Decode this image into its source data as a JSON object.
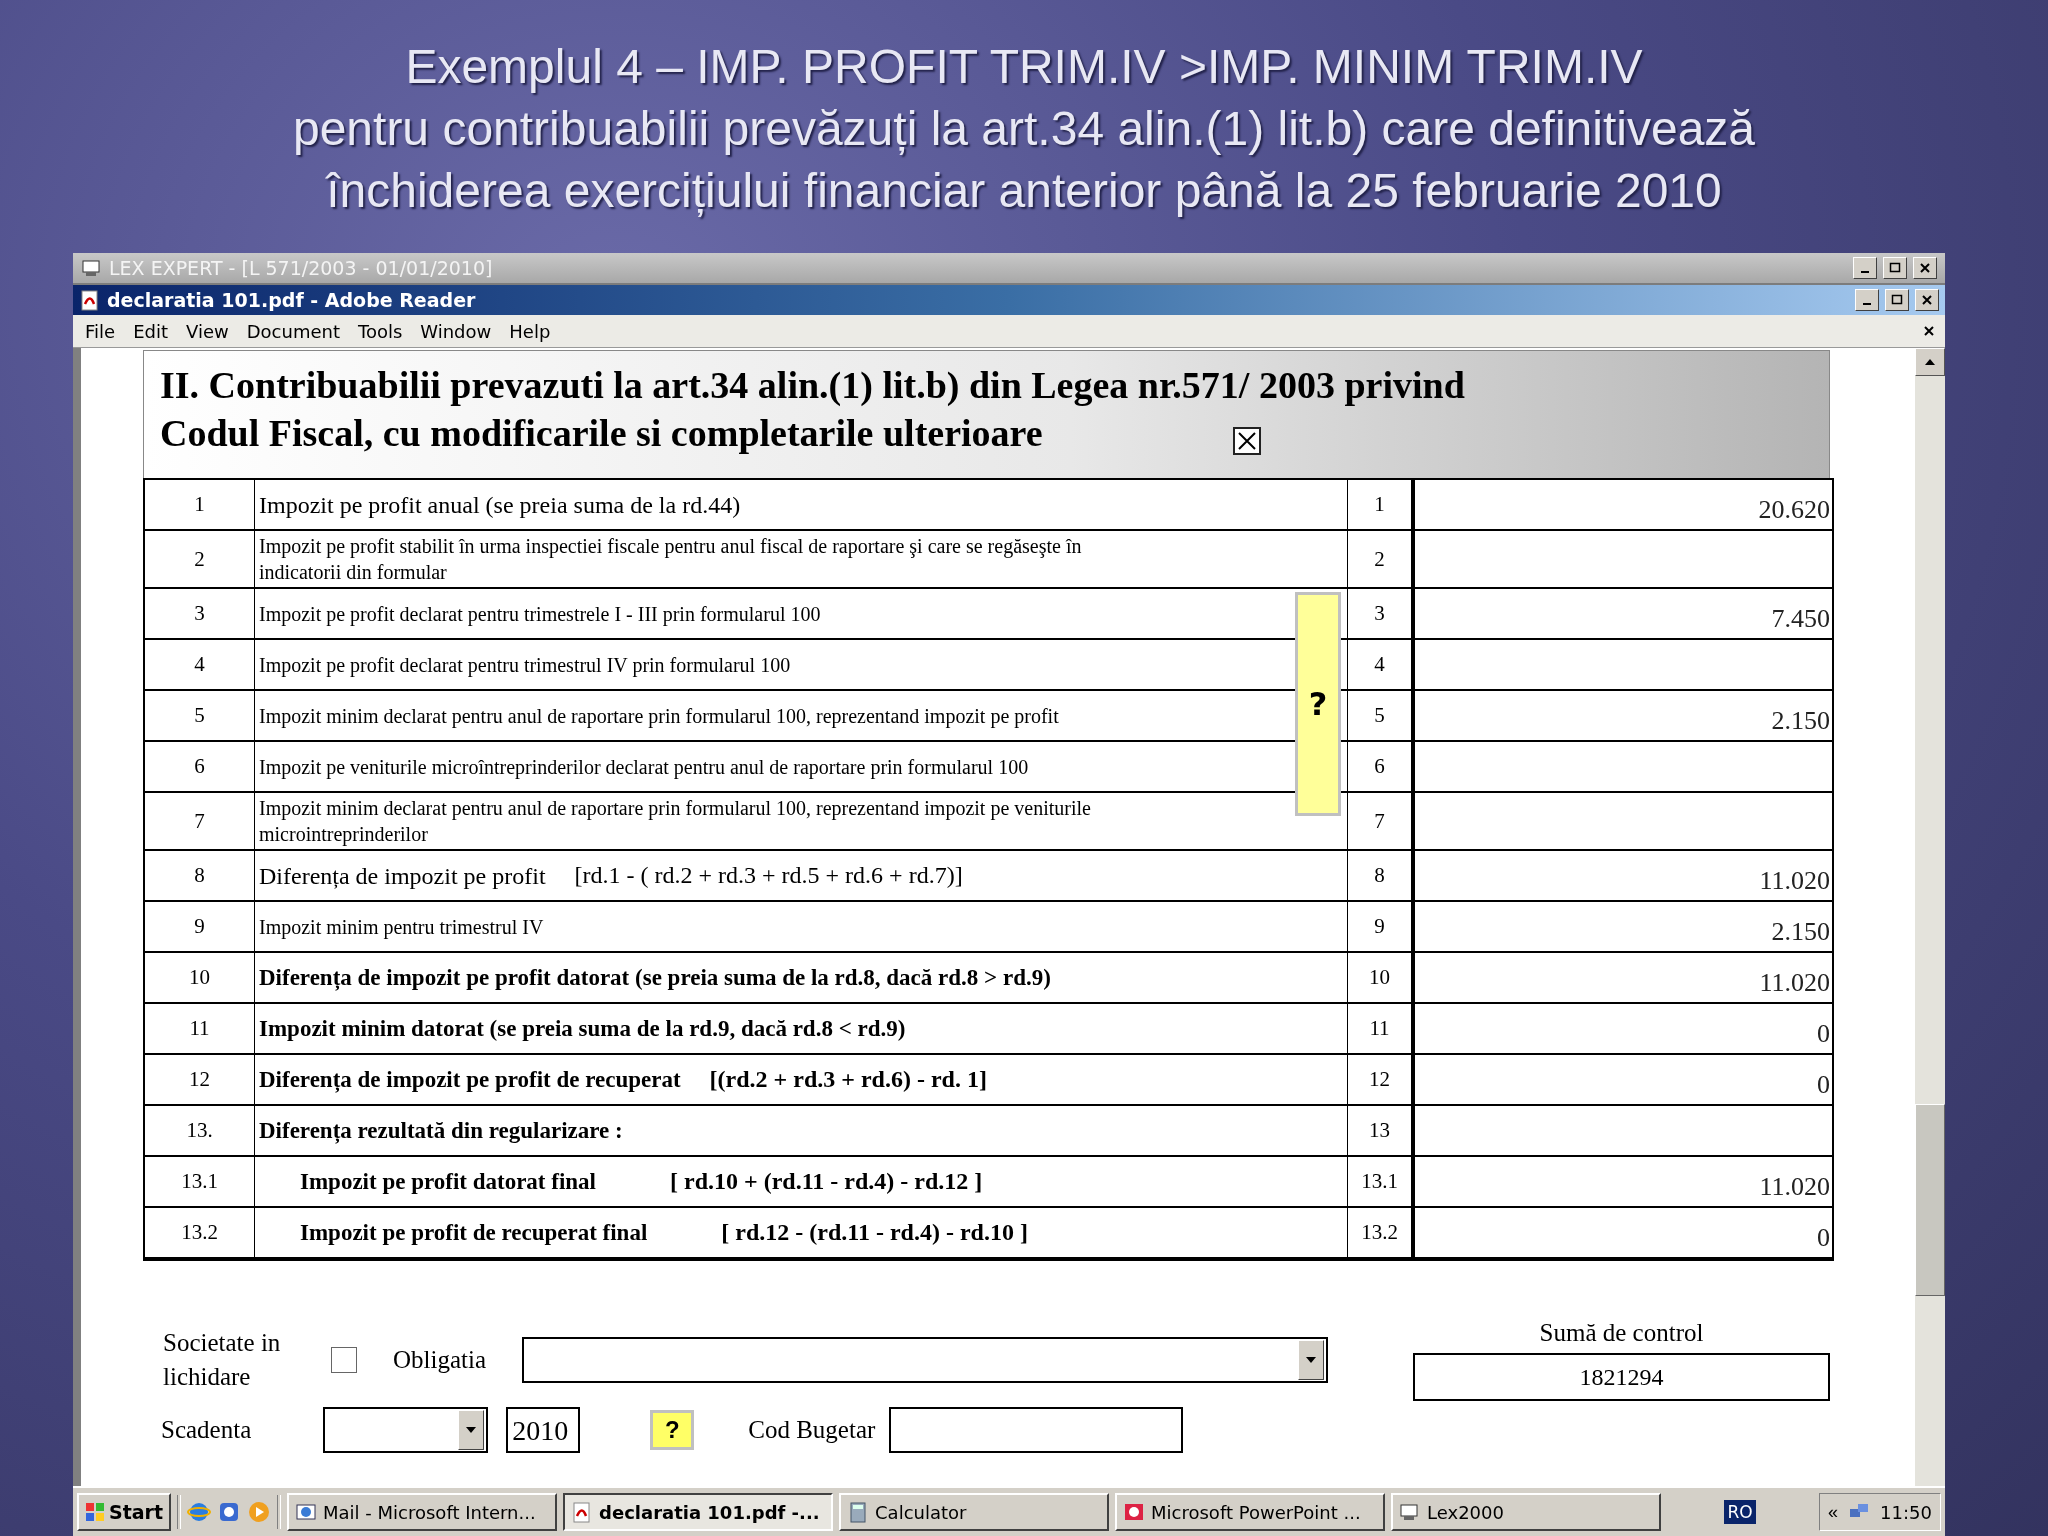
{
  "slide": {
    "title_lines": [
      "Exemplul 4 – IMP. PROFIT TRIM.IV >IMP. MINIM TRIM.IV",
      "pentru contribuabilii prevăzuți la art.34 alin.(1) lit.b) care definitivează",
      "închiderea exercițiului financiar anterior până la 25 februarie 2010"
    ]
  },
  "back_window": {
    "title": "LEX EXPERT - [L 571/2003 - 01/01/2010]"
  },
  "window": {
    "title": "declaratia 101.pdf - Adobe Reader"
  },
  "menu": [
    "File",
    "Edit",
    "View",
    "Document",
    "Tools",
    "Window",
    "Help"
  ],
  "form": {
    "heading_lines": [
      "II.  Contribuabilii prevazuti la art.34 alin.(1) lit.b) din Legea nr.571/ 2003 privind",
      "Codul Fiscal, cu modificarile si completarile ulterioare"
    ],
    "heading_checkbox": {
      "checked": true
    },
    "help_button": "?",
    "rows": [
      {
        "num": "1",
        "kind": "normal",
        "label": "Impozit pe profit anual (se preia suma de la rd.44)",
        "code": "1",
        "value": "20.620"
      },
      {
        "num": "2",
        "kind": "small",
        "label": "Impozit pe profit stabilit în urma inspectiei fiscale pentru anul fiscal de raportare şi care se regăseşte în indicatorii din formular",
        "code": "2"
      },
      {
        "num": "3",
        "kind": "small",
        "label": "Impozit pe profit declarat pentru trimestrele I - III prin formularul 100",
        "code": "3",
        "value": "7.450"
      },
      {
        "num": "4",
        "kind": "small",
        "label": "Impozit pe profit declarat pentru trimestrul IV prin formularul 100",
        "code": "4"
      },
      {
        "num": "5",
        "kind": "small",
        "label": "Impozit minim declarat pentru anul de raportare prin formularul 100, reprezentand impozit pe profit",
        "code": "5",
        "value": "2.150"
      },
      {
        "num": "6",
        "kind": "small",
        "label": "Impozit pe veniturile microîntreprinderilor declarat pentru anul de raportare prin formularul 100",
        "code": "6"
      },
      {
        "num": "7",
        "kind": "small",
        "label": "Impozit minim declarat pentru anul de raportare prin formularul 100, reprezentand impozit pe veniturile microintreprinderilor",
        "code": "7"
      },
      {
        "num": "8",
        "kind": "normal",
        "label": "Diferența de impozit pe profit",
        "formula": "[rd.1 - ( rd.2 + rd.3 + rd.5 + rd.6 + rd.7)]",
        "code": "8",
        "value": "11.020"
      },
      {
        "num": "9",
        "kind": "small",
        "label": "Impozit minim pentru trimestrul IV",
        "code": "9",
        "value": "2.150"
      },
      {
        "num": "10",
        "kind": "bold",
        "label": "Diferența de impozit pe profit datorat (se preia suma de la rd.8, dacă rd.8 > rd.9)",
        "code": "10",
        "value": "11.020"
      },
      {
        "num": "11",
        "kind": "bold",
        "label": "Impozit minim datorat (se preia suma de la rd.9, dacă rd.8 < rd.9)",
        "code": "11",
        "value": "0"
      },
      {
        "num": "12",
        "kind": "bold",
        "label": "Diferența de impozit pe profit de recuperat",
        "formula": "[(rd.2 + rd.3 + rd.6) - rd. 1]",
        "code": "12",
        "value": "0"
      },
      {
        "num": "13.",
        "kind": "bold",
        "label": "Diferența rezultată din regularizare :",
        "code": "13"
      },
      {
        "num": "13.1",
        "kind": "sub",
        "label": "Impozit pe profit datorat final",
        "formula": "[ rd.10 + (rd.11 - rd.4) - rd.12 ]",
        "code": "13.1",
        "value": "11.020"
      },
      {
        "num": "13.2",
        "kind": "sub",
        "label": "Impozit pe profit de recuperat final",
        "formula": "[ rd.12 - (rd.11 - rd.4) - rd.10 ]",
        "code": "13.2",
        "value": "0"
      }
    ],
    "liquidation": {
      "label": "Societate in lichidare",
      "checked": false
    },
    "obligation": {
      "label": "Obligatia"
    },
    "control_sum": {
      "label": "Sumă de control",
      "value": "1821294"
    },
    "due": {
      "label": "Scadenta",
      "year": "2010",
      "help": "?"
    },
    "budget_code": {
      "label": "Cod Bugetar"
    }
  },
  "taskbar": {
    "start": "Start",
    "items": [
      {
        "label": "Mail - Microsoft Intern...",
        "kind": "mail",
        "selected": false
      },
      {
        "label": "declaratia 101.pdf -...",
        "kind": "pdf",
        "selected": true
      },
      {
        "label": "Calculator",
        "kind": "calc",
        "selected": false
      },
      {
        "label": "Microsoft PowerPoint ...",
        "kind": "ppt",
        "selected": false
      },
      {
        "label": "Lex2000",
        "kind": "lex",
        "selected": false
      }
    ],
    "language": "RO",
    "chevron": "«",
    "clock": "11:50"
  }
}
